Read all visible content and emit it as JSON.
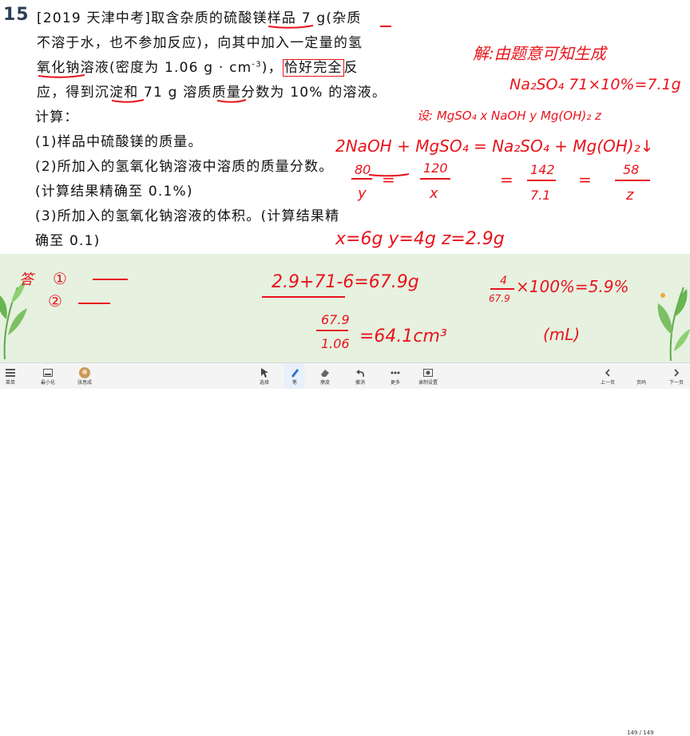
{
  "problem": {
    "number": "15",
    "lines": [
      "[2019 天津中考]取含杂质的硫酸镁样品 7 g(杂质",
      "不溶于水，也不参加反应)，向其中加入一定量的氢",
      "氧化钠溶液(密度为 1.06 g · cm",
      "应，得到沉淀和 71 g 溶质质量分数为 10% 的溶液。",
      "计算：",
      "(1)样品中硫酸镁的质量。",
      "(2)所加入的氢氧化钠溶液中溶质的质量分数。",
      "(计算结果精确至 0.1%)",
      "(3)所加入的氢氧化钠溶液的体积。(计算结果精",
      "确至 0.1)"
    ],
    "line3_exponent": "-3",
    "line3_boxed": "恰好完全",
    "line3_tail": "反"
  },
  "handwriting": {
    "note_top": "解:由题意可知生成",
    "na2so4_calc": "Na₂SO₄ 71×10%=7.1g",
    "let_line": "设: MgSO₄ x   NaOH y   Mg(OH)₂ z",
    "equation": "2NaOH + MgSO₄ = Na₂SO₄ + Mg(OH)₂↓",
    "ratio_1_num": "80",
    "ratio_1_den": "y",
    "ratio_2_num": "120",
    "ratio_2_den": "x",
    "ratio_3_num": "142",
    "ratio_3_den": "7.1",
    "ratio_4_num": "58",
    "ratio_4_den": "z",
    "eq_sign_1": "=",
    "eq_sign_2": "=",
    "eq_sign_3": "=",
    "results": "x=6g  y=4g  z=2.9g",
    "answer_label": "答",
    "answer_1": "①",
    "answer_2": "②",
    "mass_calc": "2.9+71-6=67.9g",
    "percent_num": "4",
    "percent_den": "67.9",
    "percent_rest": "×100%=5.9%",
    "vol_num": "67.9",
    "vol_den": "1.06",
    "vol_result": "=64.1cm³",
    "vol_unit": "(mL)"
  },
  "toolbar": {
    "menu_label": "菜单",
    "minimize_label": "最小化",
    "user_label": "张思成",
    "select_label": "选择",
    "pen_label": "笔",
    "eraser_label": "擦皮",
    "undo_label": "撤消",
    "more_label": "更多",
    "recorder_label": "录制设置",
    "prev_label": "上一页",
    "page_indicator": "149 / 149",
    "pages_label": "页码",
    "next_label": "下一页"
  },
  "colors": {
    "ink": "#e8141c",
    "band": "#e6f1e0",
    "accent": "#2b6fc8"
  }
}
